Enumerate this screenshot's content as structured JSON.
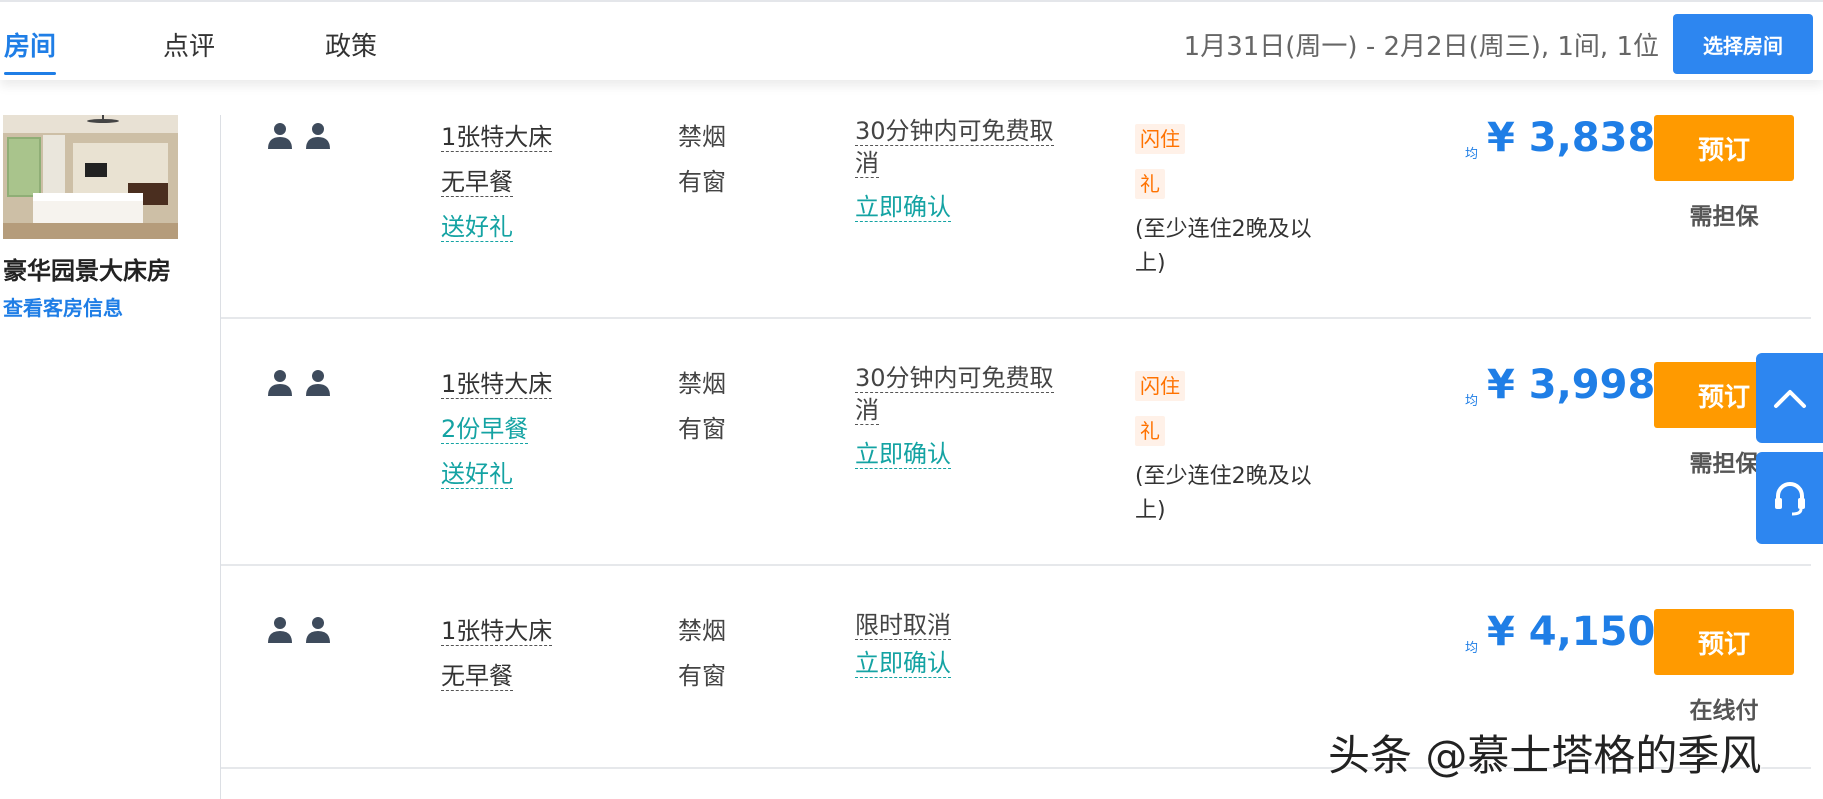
{
  "tabs": [
    {
      "label": "房间",
      "active": true
    },
    {
      "label": "点评",
      "active": false
    },
    {
      "label": "政策",
      "active": false
    }
  ],
  "search": {
    "dates": "1月31日(周一) - 2月2日(周三), 1间, 1位",
    "select_button": "选择房间"
  },
  "room": {
    "name": "豪华园景大床房",
    "info_link": "查看客房信息",
    "image_icon": "room-photo"
  },
  "rates": [
    {
      "bed": "1张特大床",
      "breakfast": "无早餐",
      "breakfast_link": false,
      "gift": "送好礼",
      "smoking": "禁烟",
      "window": "有窗",
      "cancel": "30分钟内可免费取消",
      "confirm": "立即确认",
      "tags": [
        "闪住",
        "礼"
      ],
      "stay_note": "(至少连住2晚及以上)",
      "avg_label": "均",
      "price": "¥ 3,838",
      "book_label": "预订",
      "payment": "需担保"
    },
    {
      "bed": "1张特大床",
      "breakfast": "2份早餐",
      "breakfast_link": true,
      "gift": "送好礼",
      "smoking": "禁烟",
      "window": "有窗",
      "cancel": "30分钟内可免费取消",
      "confirm": "立即确认",
      "tags": [
        "闪住",
        "礼"
      ],
      "stay_note": "(至少连住2晚及以上)",
      "avg_label": "均",
      "price": "¥ 3,998",
      "book_label": "预订",
      "payment": "需担保"
    },
    {
      "bed": "1张特大床",
      "breakfast": "无早餐",
      "breakfast_link": false,
      "gift": "",
      "smoking": "禁烟",
      "window": "有窗",
      "cancel": "限时取消",
      "confirm": "立即确认",
      "tags": [],
      "stay_note": "",
      "avg_label": "均",
      "price": "¥ 4,150",
      "book_label": "预订",
      "payment": "在线付"
    }
  ],
  "floating": {
    "top_icon": "chevron-up-icon",
    "service_icon": "headset-icon"
  },
  "watermark": "头条 @慕士塔格的季风",
  "colors": {
    "primary": "#1f7ee6",
    "button_blue": "#2d86f0",
    "book_orange": "#ff9a00",
    "teal_link": "#14a3a3",
    "tag_orange": "#ff7200"
  }
}
